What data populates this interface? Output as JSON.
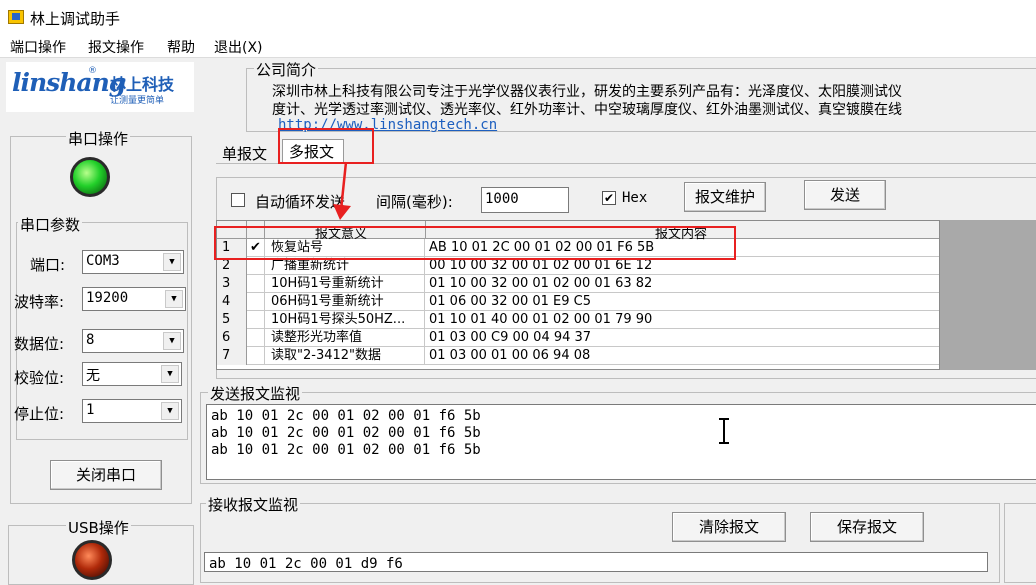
{
  "window": {
    "title": "林上调试助手"
  },
  "menu": [
    "端口操作",
    "报文操作",
    "帮助",
    "退出(X)"
  ],
  "logo": {
    "en": "linshang",
    "cn": "林上科技",
    "slogan": "让测量更简单",
    "reg": "®"
  },
  "serial": {
    "title": "串口操作",
    "params_title": "串口参数",
    "fields": [
      {
        "label": "端口:",
        "value": "COM3"
      },
      {
        "label": "波特率:",
        "value": "19200"
      },
      {
        "label": "数据位:",
        "value": "8"
      },
      {
        "label": "校验位:",
        "value": "无"
      },
      {
        "label": "停止位:",
        "value": "1"
      }
    ],
    "close_button": "关闭串口",
    "status_color": "#22d02a"
  },
  "usb": {
    "title": "USB操作",
    "status_color": "#b02a0a"
  },
  "company": {
    "title": "公司简介",
    "line1": "深圳市林上科技有限公司专注于光学仪器仪表行业，研发的主要系列产品有：光泽度仪、太阳膜测试仪",
    "line2": "度计、光学透过率测试仪、透光率仪、红外功率计、中空玻璃厚度仪、红外油墨测试仪、真空镀膜在线",
    "link": "http://www.linshangtech.cn"
  },
  "tabs": {
    "single": "单报文",
    "multi": "多报文"
  },
  "multi": {
    "auto_loop_label": "自动循环发送",
    "interval_label": "间隔(毫秒):",
    "interval_value": "1000",
    "hex_label": "Hex",
    "hex_checked": "✔",
    "maintain_button": "报文维护",
    "send_button": "发送",
    "grid": {
      "col_name": "报文意义",
      "col_hex": "报文内容",
      "rows": [
        {
          "num": "1",
          "checked": "✔",
          "name": "恢复站号",
          "hex": "AB 10 01 2C 00 01 02 00 01 F6 5B"
        },
        {
          "num": "2",
          "checked": "",
          "name": "广播重新统计",
          "hex": "00 10 00 32 00 01 02 00 01 6E 12"
        },
        {
          "num": "3",
          "checked": "",
          "name": "10H码1号重新统计",
          "hex": "01 10 00 32 00 01 02 00 01 63 82"
        },
        {
          "num": "4",
          "checked": "",
          "name": "06H码1号重新统计",
          "hex": "01 06 00 32 00 01 E9 C5"
        },
        {
          "num": "5",
          "checked": "",
          "name": "10H码1号探头50HZ...",
          "hex": "01 10 01 40 00 01 02 00 01 79 90"
        },
        {
          "num": "6",
          "checked": "",
          "name": "读整形光功率值",
          "hex": "01 03 00 C9 00 04 94 37"
        },
        {
          "num": "7",
          "checked": "",
          "name": "读取\"2-3412\"数据",
          "hex": "01 03 00 01 00 06 94 08"
        }
      ]
    }
  },
  "send_monitor": {
    "title": "发送报文监视",
    "text": "ab 10 01 2c 00 01 02 00 01 f6 5b\nab 10 01 2c 00 01 02 00 01 f6 5b\nab 10 01 2c 00 01 02 00 01 f6 5b"
  },
  "recv_monitor": {
    "title": "接收报文监视",
    "clear_button": "清除报文",
    "save_button": "保存报文",
    "text": "ab 10 01 2c 00 01 d9 f6"
  },
  "accent_colors": {
    "annotation": "#e82020",
    "link": "#1d5fbf"
  }
}
